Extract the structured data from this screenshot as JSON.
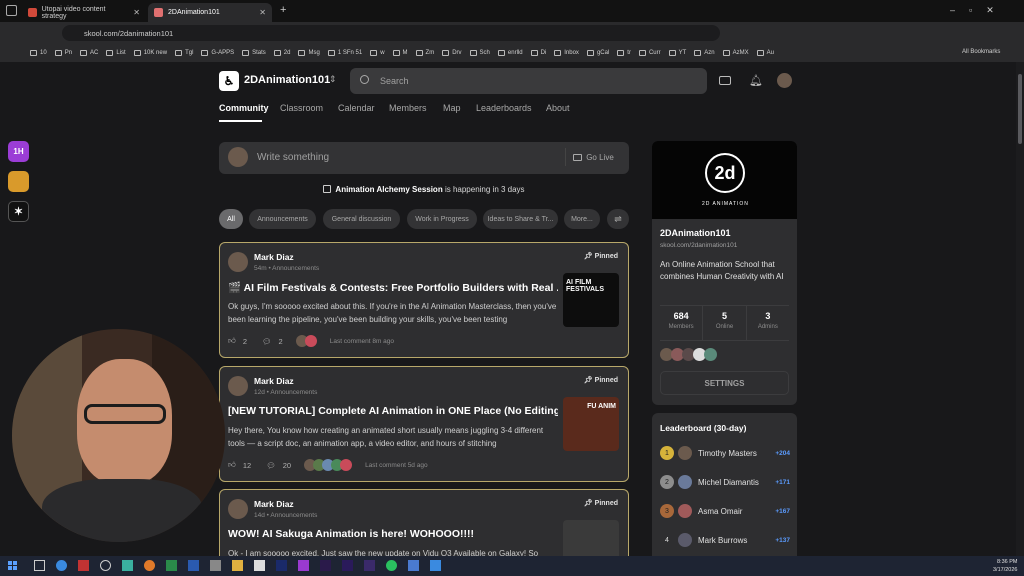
{
  "browser": {
    "tabs": [
      {
        "title": "Utopai video content strategy",
        "active": false
      },
      {
        "title": "2DAnimation101",
        "active": true
      }
    ],
    "url": "skool.com/2danimation101",
    "bookmarks": [
      "10",
      "Pn",
      "AC",
      "List",
      "10K new",
      "Tgl",
      "G-APPS",
      "Stats",
      "2d",
      "Msg",
      "1 SFn 51",
      "w",
      "M",
      "Zm",
      "Drv",
      "Sch",
      "enrlld",
      "Di",
      "Inbox",
      "gCal",
      "tr",
      "Curr",
      "YT",
      "Azn",
      "AzMX",
      "Au"
    ],
    "all_bookmarks": "All Bookmarks"
  },
  "sidebar": {
    "icons": [
      {
        "label": "1H",
        "color": "#9b3dd6"
      },
      {
        "label": "",
        "color": "#d99a2b"
      },
      {
        "label": "",
        "color": "#111111"
      }
    ]
  },
  "header": {
    "group_name": "2DAnimation101",
    "search_placeholder": "Search",
    "nav": [
      "Community",
      "Classroom",
      "Calendar",
      "Members",
      "Map",
      "Leaderboards",
      "About"
    ],
    "active_nav": "Community"
  },
  "compose": {
    "placeholder": "Write something",
    "go_live": "Go Live"
  },
  "event_banner": {
    "event_name": "Animation Alchemy Session",
    "suffix": " is happening in 3 days"
  },
  "filters": [
    "All",
    "Announcements",
    "General discussion",
    "Work in Progress",
    "Ideas to Share & Tr...",
    "More..."
  ],
  "posts": [
    {
      "author": "Mark Diaz",
      "meta": "54m • Announcements",
      "pinned": "Pinned",
      "title": "🎬 AI Film Festivals & Contests: Free Portfolio Builders with Real ...",
      "body": "Ok guys, I'm sooooo excited about this. If you're in the AI Animation Masterclass, then you've been learning the pipeline, you've been building your skills, you've been testing",
      "likes": "2",
      "comments": "2",
      "last_comment": "Last comment 8m ago",
      "thumb_text": "AI FILM FESTIVALS"
    },
    {
      "author": "Mark Diaz",
      "meta": "12d • Announcements",
      "pinned": "Pinned",
      "title": "[NEW TUTORIAL] Complete AI Animation in ONE Place (No Editing ...",
      "body": "Hey there, You know how creating an animated short usually means juggling 3-4 different tools — a script doc, an animation app, a video editor, and hours of stitching",
      "likes": "12",
      "comments": "20",
      "last_comment": "Last comment 5d ago",
      "thumb_text": "FU ANIM"
    },
    {
      "author": "Mark Diaz",
      "meta": "14d • Announcements",
      "pinned": "Pinned",
      "title": "WOW! AI Sakuga Animation is here! WOHOOO!!!!",
      "body": "Ok - I am sooooo excited. Just saw the new update on Vidu Q3 Available on Galaxy! So",
      "likes": "",
      "comments": "",
      "last_comment": "",
      "thumb_text": ""
    }
  ],
  "about": {
    "cover_caption": "2D ANIMATION",
    "name": "2DAnimation101",
    "url": "skool.com/2danimation101",
    "description": "An Online Animation School that combines Human Creativity with AI",
    "stats": [
      {
        "value": "684",
        "label": "Members"
      },
      {
        "value": "5",
        "label": "Online"
      },
      {
        "value": "3",
        "label": "Admins"
      }
    ],
    "settings": "SETTINGS"
  },
  "leaderboard": {
    "title": "Leaderboard (30-day)",
    "rows": [
      {
        "rank": "1",
        "name": "Timothy Masters",
        "points": "+204",
        "color": "#d6b33a"
      },
      {
        "rank": "2",
        "name": "Michel Diamantis",
        "points": "+171",
        "color": "#8d8d8d"
      },
      {
        "rank": "3",
        "name": "Asma Omair",
        "points": "+167",
        "color": "#a8683a"
      },
      {
        "rank": "4",
        "name": "Mark Burrows",
        "points": "+137",
        "color": "transparent"
      }
    ]
  },
  "taskbar": {
    "time": "8:36 PM",
    "date": "3/17/2026"
  }
}
